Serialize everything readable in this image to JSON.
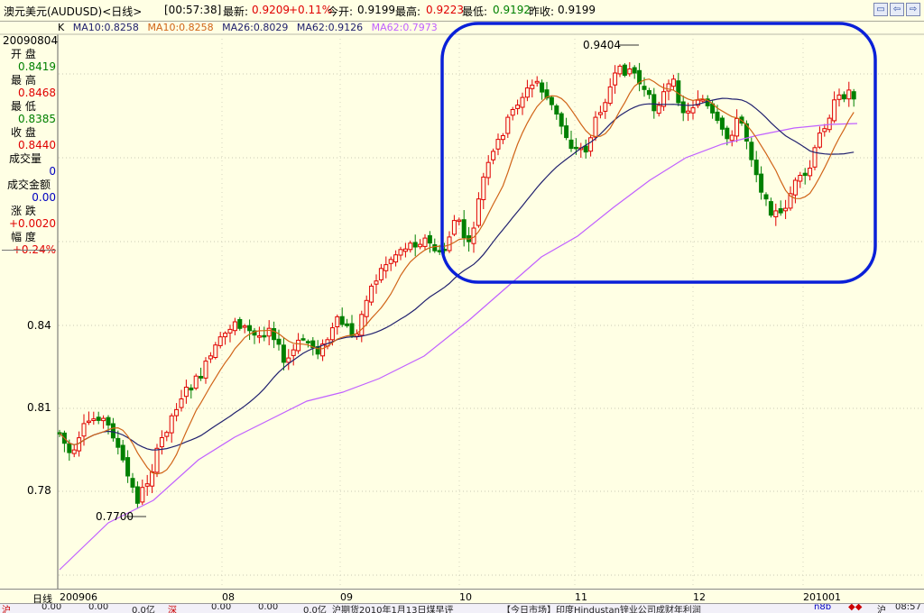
{
  "titlebar": {
    "instrument": "澳元美元(AUDUSD)<日线>",
    "time": "[00:57:38]",
    "latest_label": "最新:",
    "latest_value": "0.9209",
    "change_value": "+0.11%",
    "open_label": "今开:",
    "open_value": "0.9199",
    "high_label": "最高:",
    "high_value": "0.9223",
    "low_label": "最低:",
    "low_value": "0.9192",
    "prev_label": "昨收:",
    "prev_value": "0.9199",
    "window_buttons": [
      "restore-icon",
      "prev-icon",
      "next-icon"
    ]
  },
  "ma_line": {
    "k_label": "K",
    "ma10a": "MA10:0.8258",
    "ma10b": "MA10:0.8258",
    "ma26": "MA26:0.8029",
    "ma62a": "MA62:0.9126",
    "ma62b": "MA62:0.7973"
  },
  "info_panel": {
    "date": "20090804",
    "open_label": "开  盘",
    "open_value": "0.8419",
    "high_label": "最  高",
    "high_value": "0.8468",
    "low_label": "最  低",
    "low_value": "0.8385",
    "close_label": "收  盘",
    "close_value": "0.8440",
    "volume_label": "成交量",
    "volume_value": "0",
    "amount_label": "成交金额",
    "amount_value": "0.00",
    "change_label": "涨  跌",
    "change_value": "+0.0020",
    "pct_label": "幅  度",
    "pct_value": "+0.24%"
  },
  "y_axis": [
    "0.84",
    "0.81",
    "0.78"
  ],
  "annotations": {
    "low_marker": "0.7700",
    "high_marker": "0.9404"
  },
  "x_axis": {
    "period_label": "日线",
    "months": [
      "200906",
      "08",
      "09",
      "10",
      "11",
      "12",
      "201001"
    ]
  },
  "ticker": {
    "items": [
      "沪",
      "0.00",
      "0.00",
      "0.0亿",
      "深",
      "0.00",
      "0.00",
      "0.0亿",
      "沪期货2010年1月13日煤早评",
      "【今日市场】印度Hindustan锌业公司成财年利润",
      "n8b",
      "◆◆",
      "沪",
      "08:57"
    ]
  },
  "colors": {
    "background": "#ffffe4",
    "up_candle": "#e00000",
    "down_candle": "#008000",
    "ma_short": "#d06418",
    "ma_mid": "#20206e",
    "ma_long": "#c060ff",
    "highlight_box": "#0a20d8"
  }
}
